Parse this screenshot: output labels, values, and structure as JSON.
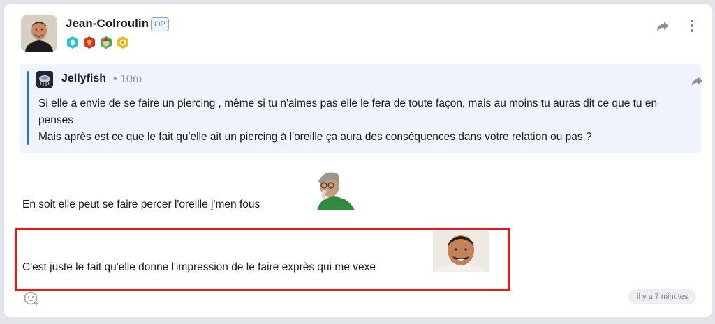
{
  "post": {
    "author": "Jean-Colroulin",
    "op_label": "OP",
    "badges": [
      "diamond-badge-icon",
      "ruby-badge-icon",
      "elf-badge-icon",
      "gold-badge-icon"
    ],
    "quote": {
      "author": "Jellyfish",
      "time": "• 10m",
      "lines": [
        "Si elle a envie de se faire un piercing , même si tu n'aimes pas elle le fera de toute façon, mais au moins tu auras dit ce que tu en penses",
        "Mais après est ce que le fait qu'elle ait un piercing à l'oreille ça aura des conséquences dans votre relation ou pas ?"
      ]
    },
    "message_1": "En soit elle peut se faire percer l'oreille j'men fous",
    "message_2": "C'est juste le fait qu'elle donne l'impression de le faire exprès qui me vexe",
    "timestamp": "il y a 7 minutes"
  },
  "colors": {
    "accent": "#2f6fde",
    "highlight": "#e61919",
    "quote_bg": "#eef3fc"
  }
}
